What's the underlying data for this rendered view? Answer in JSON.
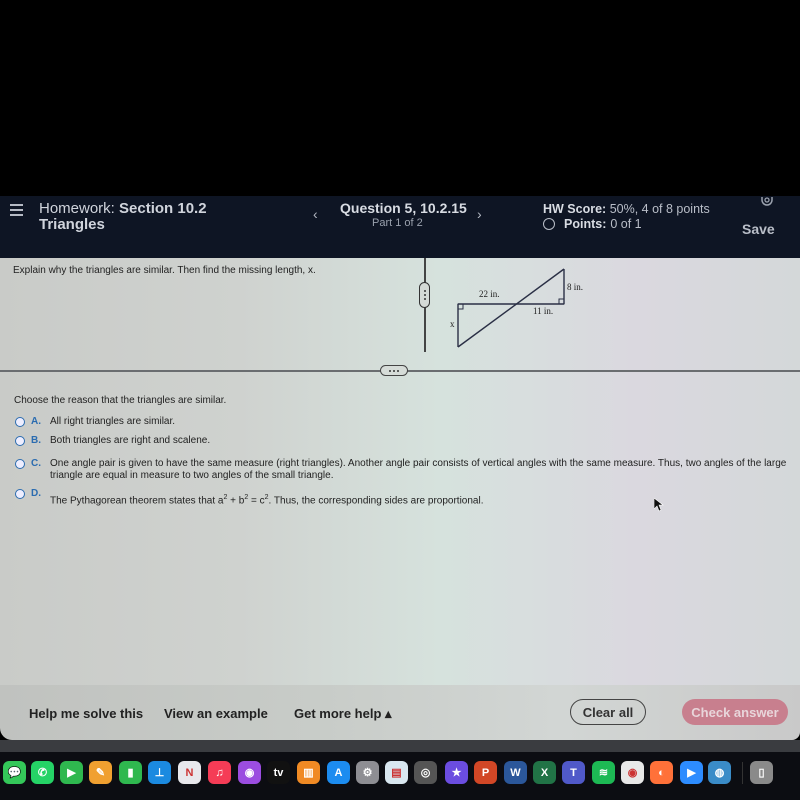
{
  "header": {
    "homework_label": "Homework:",
    "section": "Section 10.2",
    "subtitle": "Triangles",
    "question_title": "Question 5, 10.2.15",
    "question_part": "Part 1 of 2",
    "hw_score_label": "HW Score:",
    "hw_score_value": "50%, 4 of 8 points",
    "points_label": "Points:",
    "points_value": "0 of 1",
    "save_label": "Save",
    "prev_glyph": "‹",
    "next_glyph": "›"
  },
  "question": {
    "prompt": "Explain why the triangles are similar. Then find the missing length, x.",
    "figure": {
      "label_22": "22 in.",
      "label_8": "8 in.",
      "label_11": "11 in.",
      "label_x": "x"
    },
    "choose_prompt": "Choose the reason that the triangles are similar.",
    "options": [
      {
        "letter": "A.",
        "text": "All right triangles are similar."
      },
      {
        "letter": "B.",
        "text": "Both triangles are right and scalene."
      },
      {
        "letter": "C.",
        "text": "One angle pair is given to have the same measure (right triangles). Another angle pair consists of vertical angles with the same measure.  Thus, two angles of the large triangle are equal in measure to two angles of the small triangle."
      },
      {
        "letter": "D.",
        "text_before": "The Pythagorean theorem states that a",
        "text_after": ". Thus, the corresponding sides are proportional."
      }
    ]
  },
  "bottom_bar": {
    "help_me_solve": "Help me solve this",
    "view_example": "View an example",
    "get_more_help": "Get more help ▴",
    "clear_all": "Clear all",
    "check_answer": "Check answer"
  },
  "dock": {
    "apps": [
      {
        "name": "messages",
        "glyph": "💬",
        "color": "#34c759"
      },
      {
        "name": "whatsapp",
        "glyph": "✆",
        "color": "#25d366"
      },
      {
        "name": "facetime",
        "glyph": "▶",
        "color": "#2fb84f"
      },
      {
        "name": "pages",
        "glyph": "✎",
        "color": "#f0a030"
      },
      {
        "name": "numbers",
        "glyph": "▮",
        "color": "#2fb84f"
      },
      {
        "name": "keynote",
        "glyph": "⊥",
        "color": "#1b8ae0"
      },
      {
        "name": "news",
        "glyph": "N",
        "color": "#e8e8ec"
      },
      {
        "name": "music",
        "glyph": "♫",
        "color": "#f53c56"
      },
      {
        "name": "podcasts",
        "glyph": "◉",
        "color": "#9b4de0"
      },
      {
        "name": "apple-tv",
        "glyph": "tv",
        "color": "#111"
      },
      {
        "name": "books",
        "glyph": "▥",
        "color": "#f08a24"
      },
      {
        "name": "app-store",
        "glyph": "A",
        "color": "#1c8cf0"
      },
      {
        "name": "system-settings",
        "glyph": "⚙",
        "color": "#8e8e93"
      },
      {
        "name": "preview",
        "glyph": "▤",
        "color": "#d9e7f0"
      },
      {
        "name": "photo-booth",
        "glyph": "◎",
        "color": "#555"
      },
      {
        "name": "imovie",
        "glyph": "★",
        "color": "#6b4de0"
      },
      {
        "name": "powerpoint",
        "glyph": "P",
        "color": "#d24726"
      },
      {
        "name": "word",
        "glyph": "W",
        "color": "#2b579a"
      },
      {
        "name": "excel",
        "glyph": "X",
        "color": "#217346"
      },
      {
        "name": "teams",
        "glyph": "T",
        "color": "#5059c9"
      },
      {
        "name": "spotify",
        "glyph": "≋",
        "color": "#1db954"
      },
      {
        "name": "chrome",
        "glyph": "◉",
        "color": "#e8e8e8"
      },
      {
        "name": "firefox",
        "glyph": "◐",
        "color": "#ff7139"
      },
      {
        "name": "zoom",
        "glyph": "▶",
        "color": "#2d8cff"
      },
      {
        "name": "network-globe",
        "glyph": "◍",
        "color": "#3a8cc8"
      },
      {
        "name": "trash",
        "glyph": "▯",
        "color": "#8a8a8a"
      }
    ]
  }
}
